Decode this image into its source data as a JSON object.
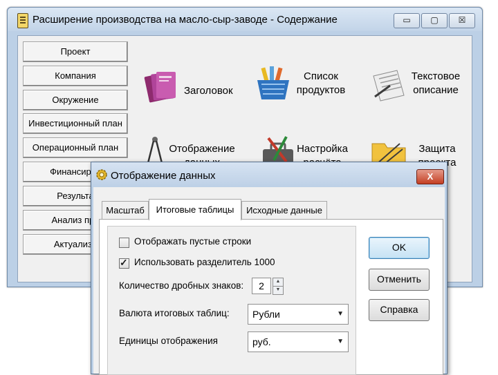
{
  "main_window": {
    "title": "Расширение производства на масло-сыр-заводе - Содержание",
    "controls": {
      "minimize": "▭",
      "maximize": "▢",
      "close": "☒"
    }
  },
  "nav": [
    "Проект",
    "Компания",
    "Окружение",
    "Инвестиционный план",
    "Операционный план",
    "Финансиров",
    "Результа",
    "Анализ про",
    "Актуализа"
  ],
  "tiles": {
    "header": "Заголовок",
    "products_line1": "Список",
    "products_line2": "продуктов",
    "text_desc_line1": "Текстовое",
    "text_desc_line2": "описание",
    "display_line1": "Отображение",
    "display_line2": "данных",
    "calc_line1": "Настройка",
    "calc_line2": "расчёта",
    "protect_line1": "Защита",
    "protect_line2": "проекта"
  },
  "dialog": {
    "title": "Отображение данных",
    "close": "X",
    "tabs": [
      "Масштаб",
      "Итоговые таблицы",
      "Исходные данные"
    ],
    "active_tab": "Итоговые таблицы",
    "show_empty_rows": {
      "label": "Отображать пустые строки",
      "checked": false
    },
    "use_separator": {
      "label": "Использовать разделитель 1000",
      "checked": true
    },
    "decimals_label": "Количество дробных знаков:",
    "decimals_value": "2",
    "currency_label": "Валюта итоговых таблиц:",
    "currency_value": "Рубли",
    "units_label": "Единицы отображения",
    "units_value": "руб.",
    "buttons": {
      "ok": "OK",
      "cancel": "Отменить",
      "help": "Справка"
    }
  },
  "colors": {
    "frame": "#bcd0e6",
    "dialog_close": "#c43f23",
    "ok_border": "#3c7fb1"
  }
}
